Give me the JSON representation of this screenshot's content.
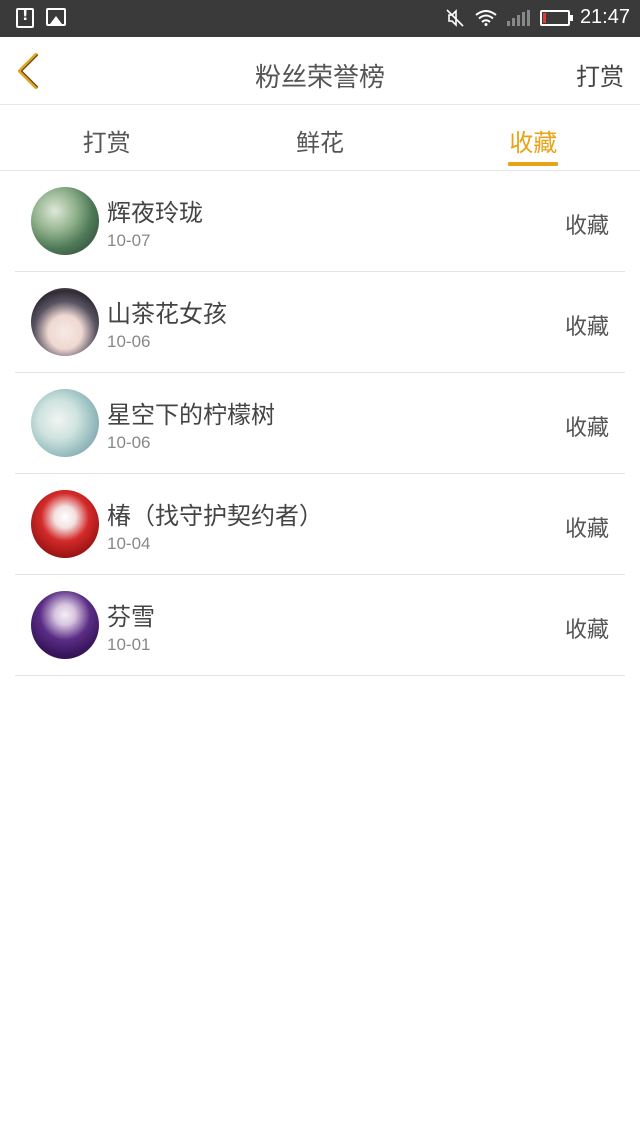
{
  "status_bar": {
    "time": "21:47"
  },
  "header": {
    "title": "粉丝荣誉榜",
    "action_label": "打赏",
    "accent_color": "#e8a317"
  },
  "tabs": [
    {
      "label": "打赏",
      "active": false
    },
    {
      "label": "鲜花",
      "active": false
    },
    {
      "label": "收藏",
      "active": true
    }
  ],
  "list": [
    {
      "name": "辉夜玲珑",
      "date": "10-07",
      "action": "收藏"
    },
    {
      "name": "山茶花女孩",
      "date": "10-06",
      "action": "收藏"
    },
    {
      "name": "星空下的柠檬树",
      "date": "10-06",
      "action": "收藏"
    },
    {
      "name": "椿（找守护契约者）",
      "date": "10-04",
      "action": "收藏"
    },
    {
      "name": "芬雪",
      "date": "10-01",
      "action": "收藏"
    }
  ]
}
